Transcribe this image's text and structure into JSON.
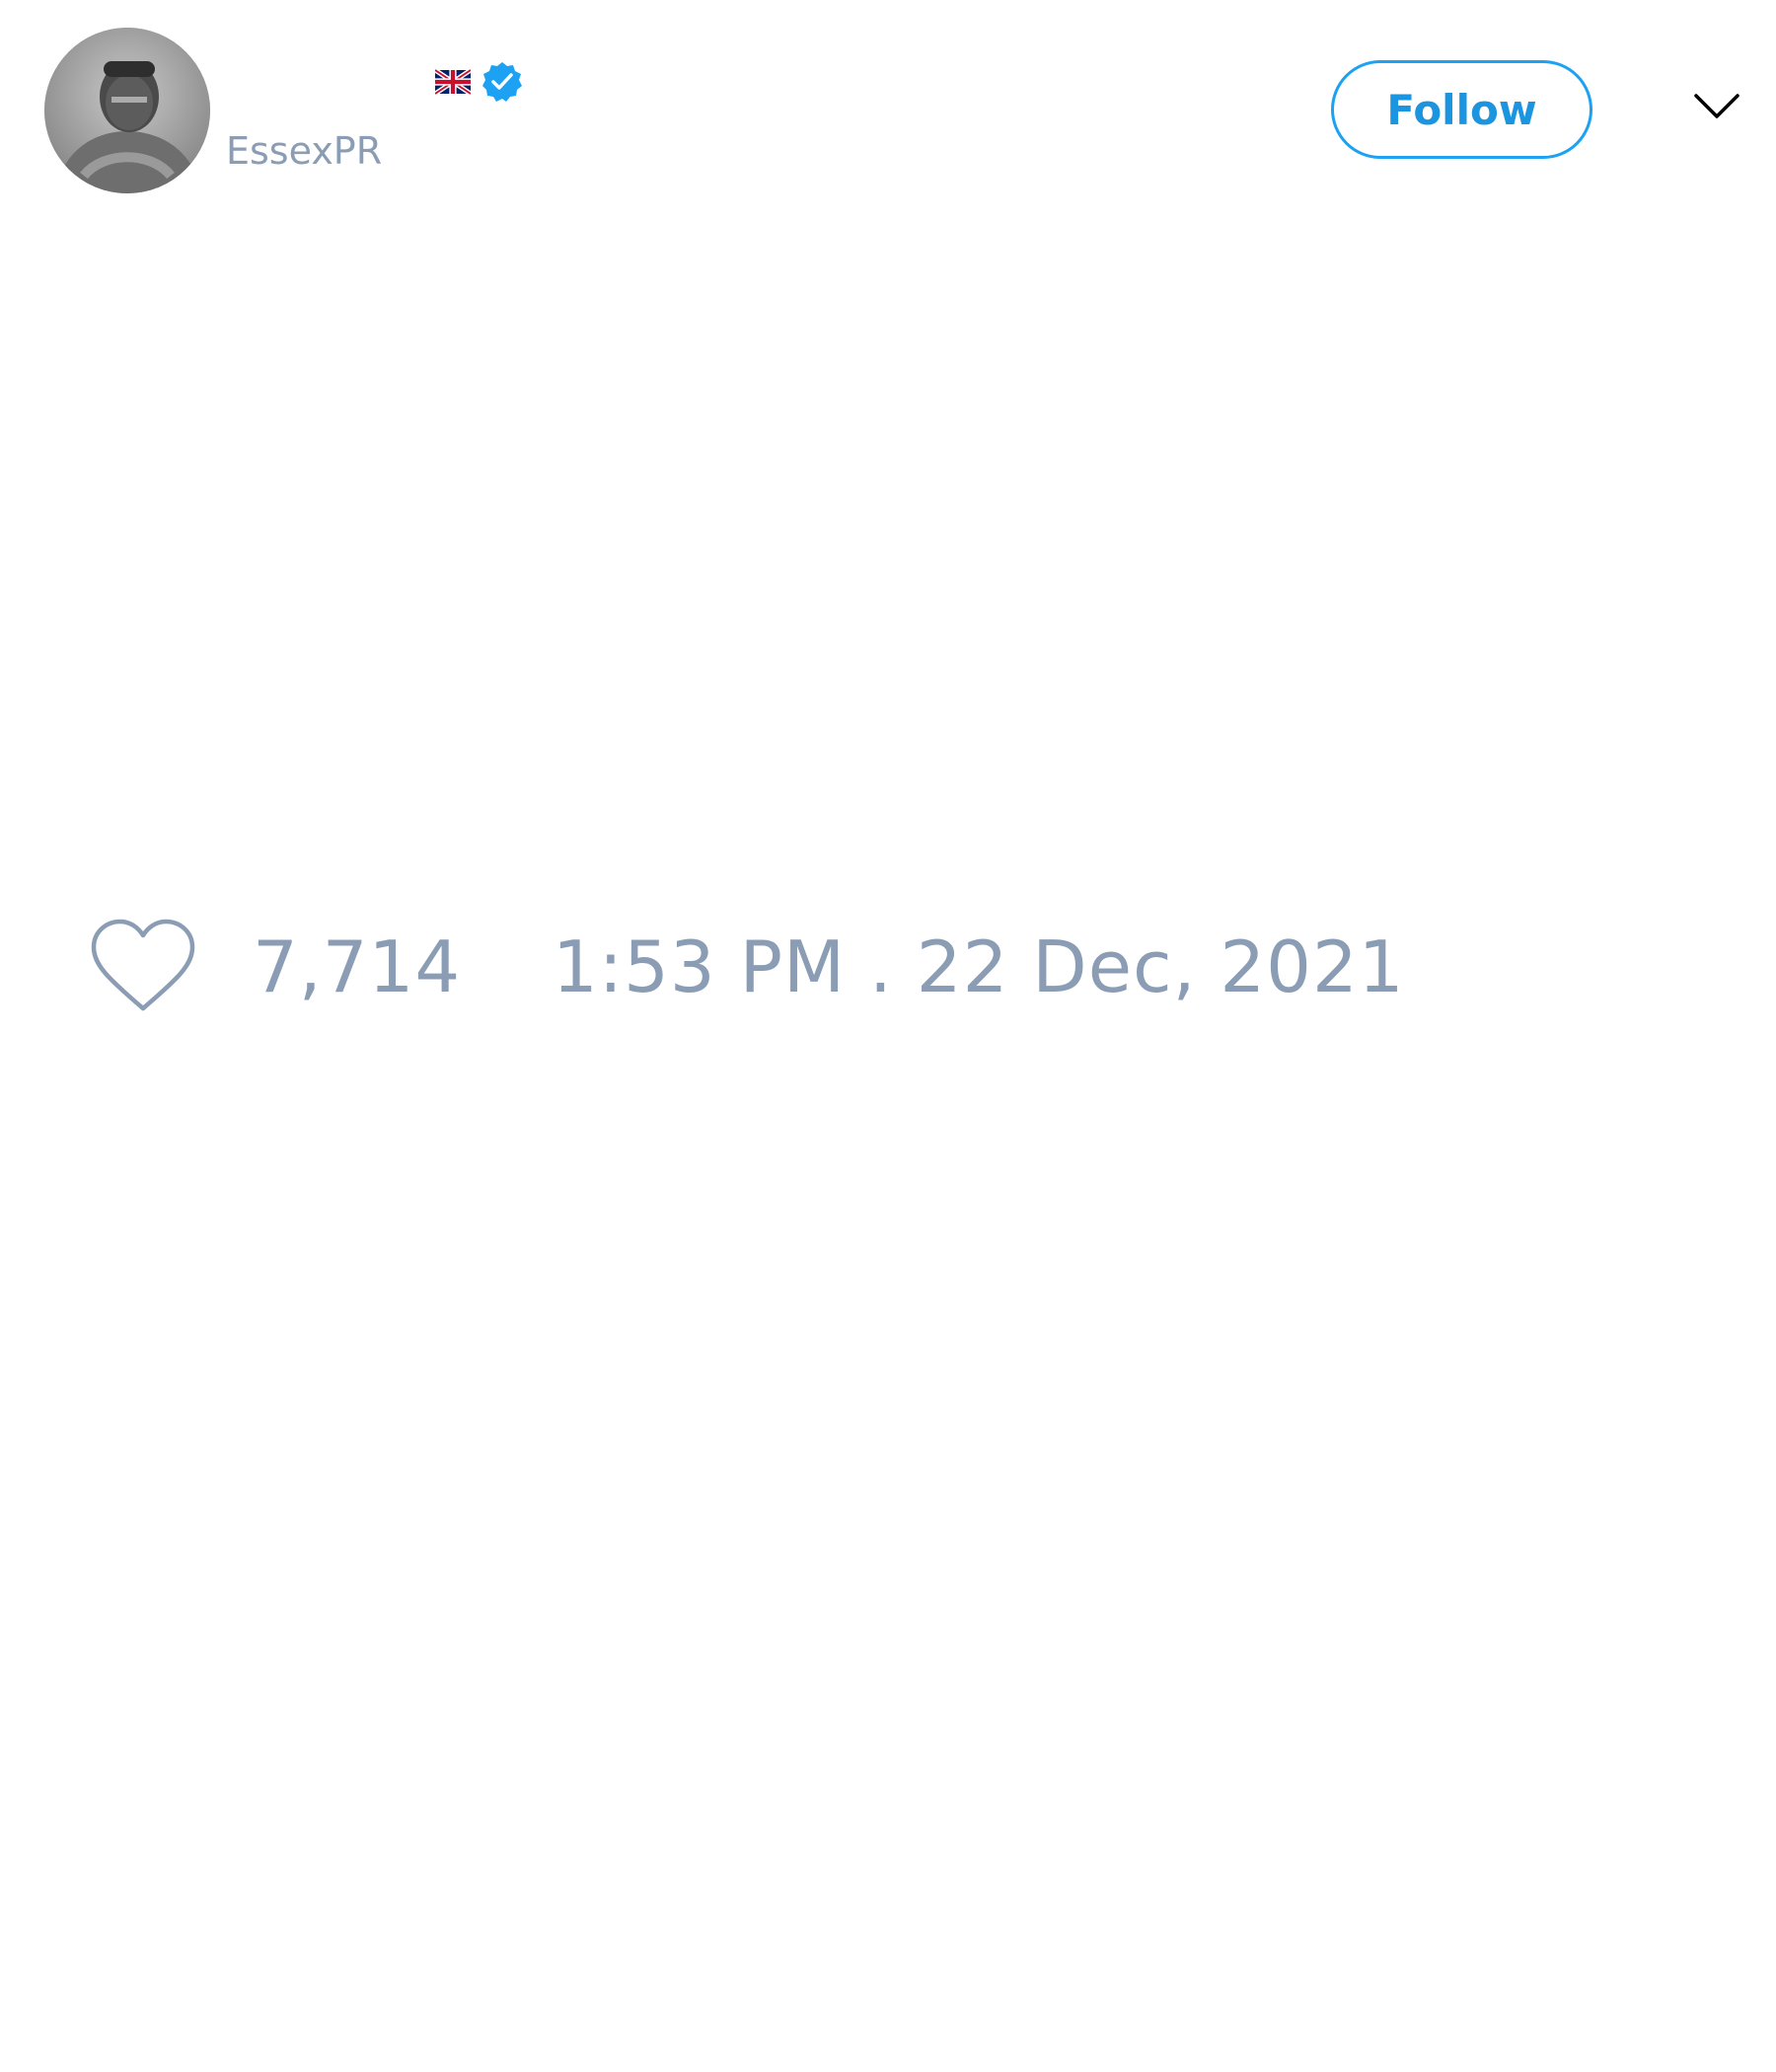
{
  "user": {
    "handle": "EssexPR",
    "flag_icon": "uk-flag-icon",
    "verified_icon": "verified-badge-icon",
    "verified_color": "#1da1f2",
    "avatar": "grayscale-portrait-photo"
  },
  "actions": {
    "follow_label": "Follow",
    "follow_color": "#1da1f2",
    "menu_icon": "chevron-down-icon"
  },
  "footer": {
    "like_icon": "heart-icon",
    "like_count": "7,714",
    "timestamp": "1:53 PM . 22 Dec, 2021",
    "text_color": "#8b9db4"
  }
}
